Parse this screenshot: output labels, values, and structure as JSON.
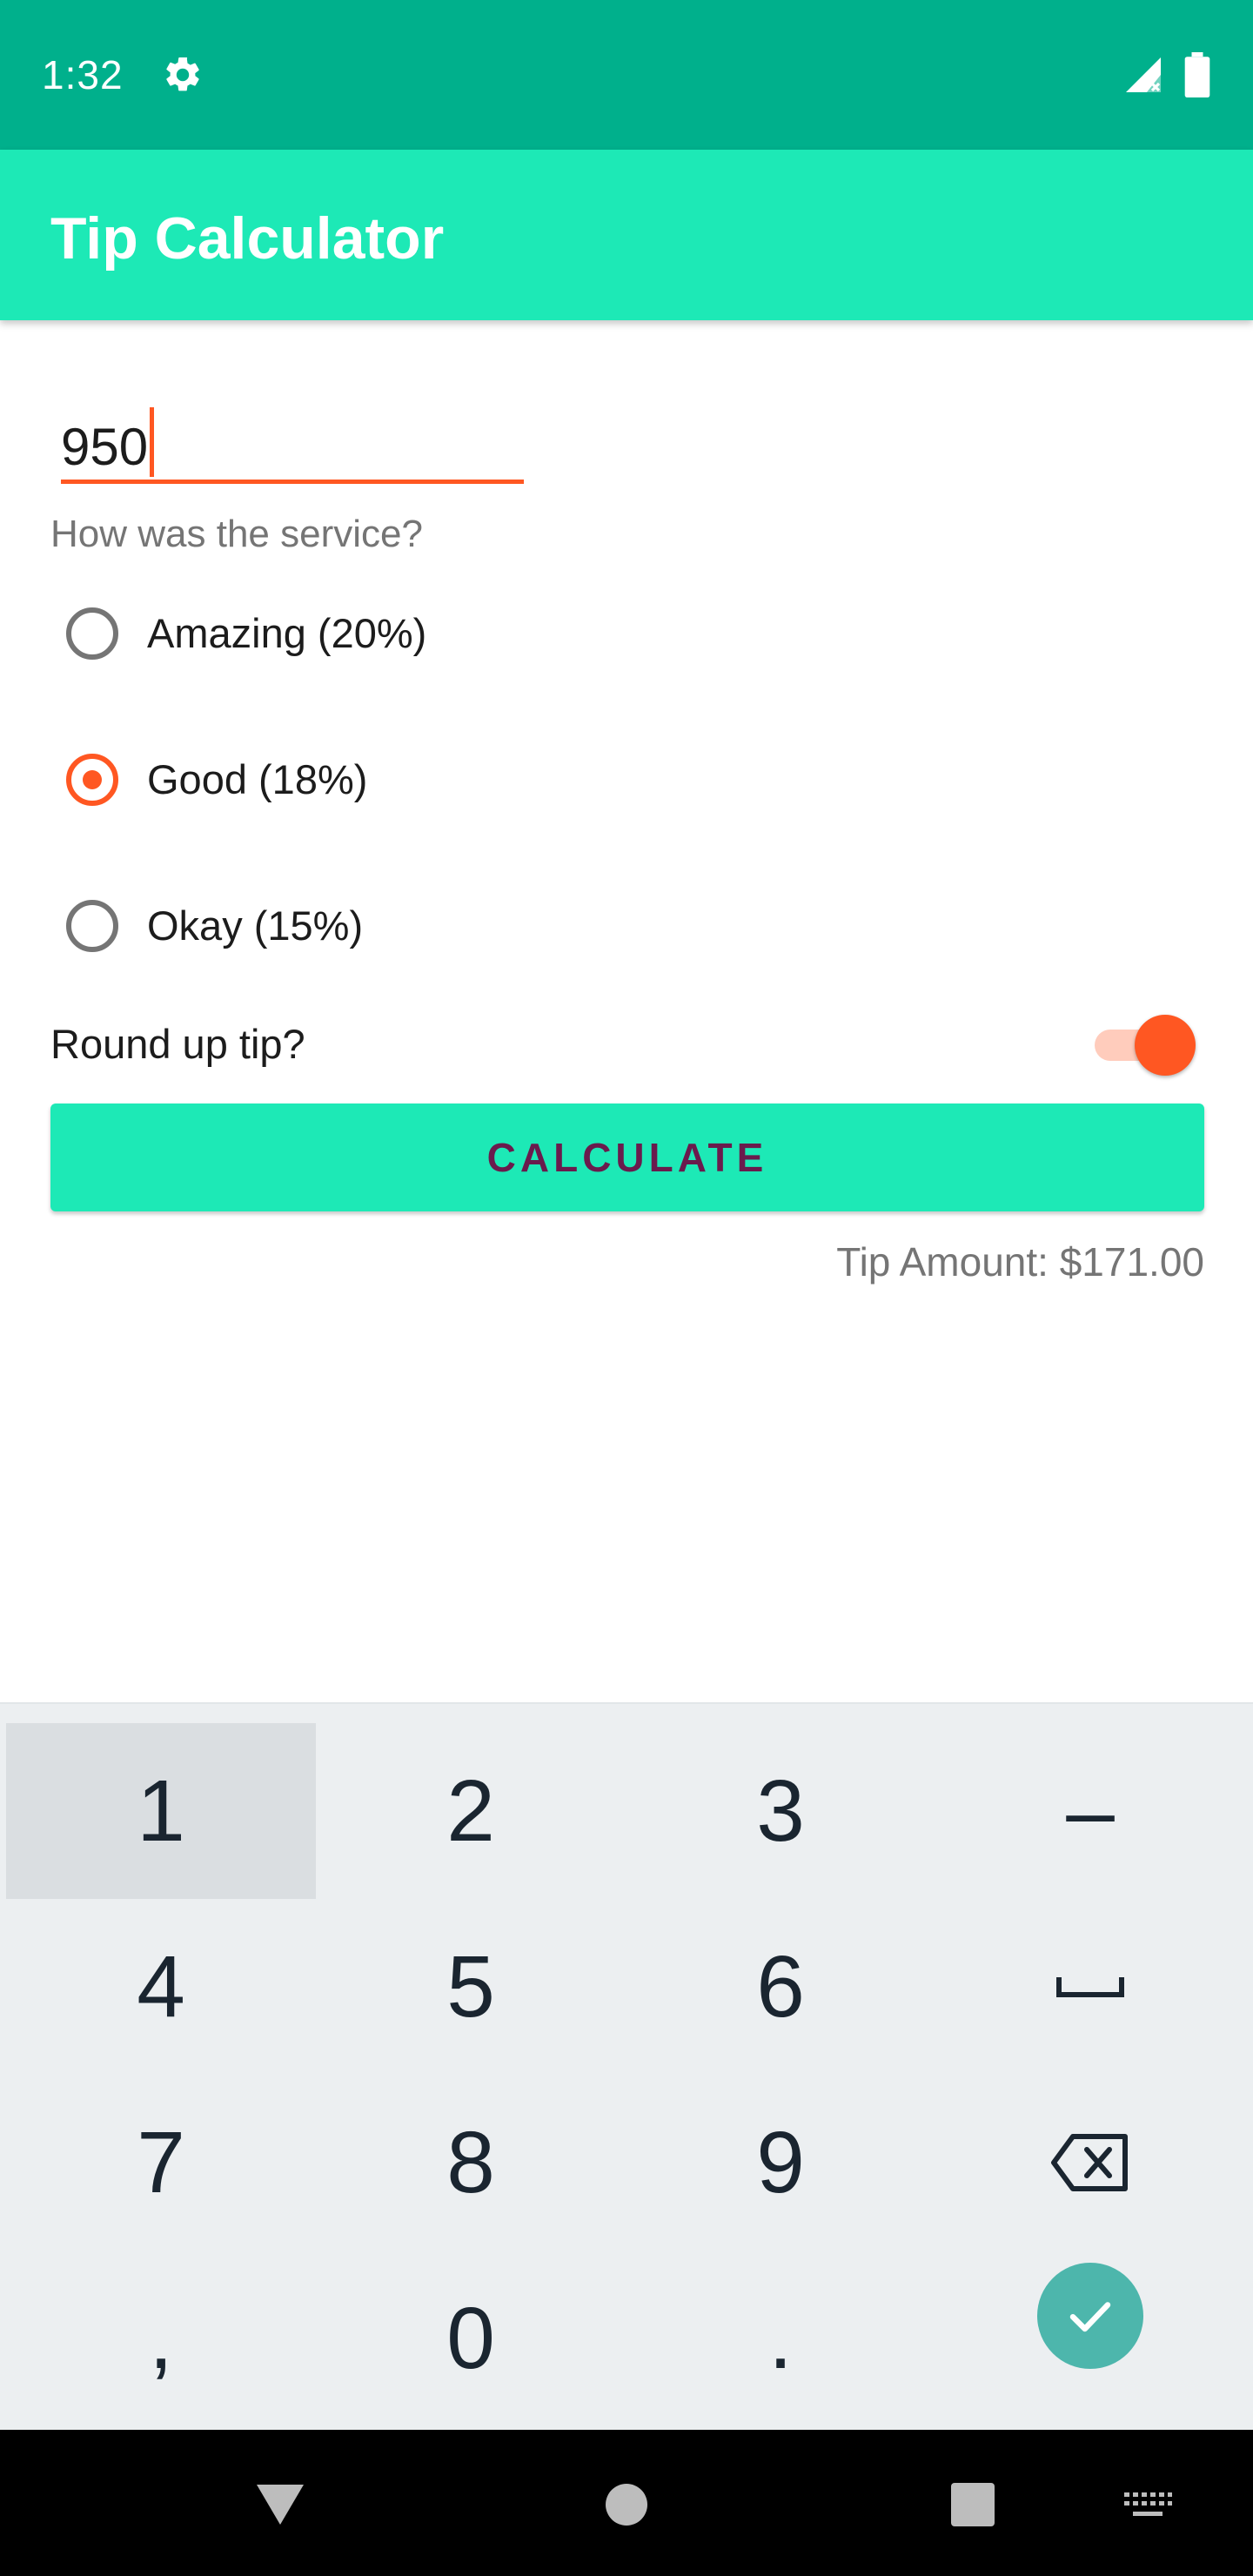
{
  "status_bar": {
    "time": "1:32",
    "icons": [
      "gear-icon",
      "signal-icon",
      "battery-icon"
    ],
    "background": "#00b08c"
  },
  "app_bar": {
    "title": "Tip Calculator",
    "background": "#1de9b6"
  },
  "cost_input": {
    "value": "950",
    "accent": "#ff5722"
  },
  "service": {
    "question": "How was the service?",
    "options": [
      {
        "label": "Amazing (20%)",
        "checked": false
      },
      {
        "label": "Good (18%)",
        "checked": true
      },
      {
        "label": "Okay (15%)",
        "checked": false
      }
    ]
  },
  "round_up": {
    "label": "Round up tip?",
    "checked": true
  },
  "calculate_button": {
    "label": "CALCULATE",
    "background": "#1de9b6",
    "text_color": "#6a1b4d"
  },
  "result": {
    "tip_amount": "Tip Amount: $171.00"
  },
  "keyboard": {
    "rows": [
      [
        "1",
        "2",
        "3",
        "–"
      ],
      [
        "4",
        "5",
        "6",
        "space-icon"
      ],
      [
        "7",
        "8",
        "9",
        "backspace-icon"
      ],
      [
        ",",
        "0",
        ".",
        "done-check-icon"
      ]
    ],
    "pressed_key": "1"
  },
  "nav_bar": {
    "icons": [
      "back-triangle-icon",
      "home-circle-icon",
      "recents-square-icon",
      "keyboard-switch-icon"
    ]
  }
}
